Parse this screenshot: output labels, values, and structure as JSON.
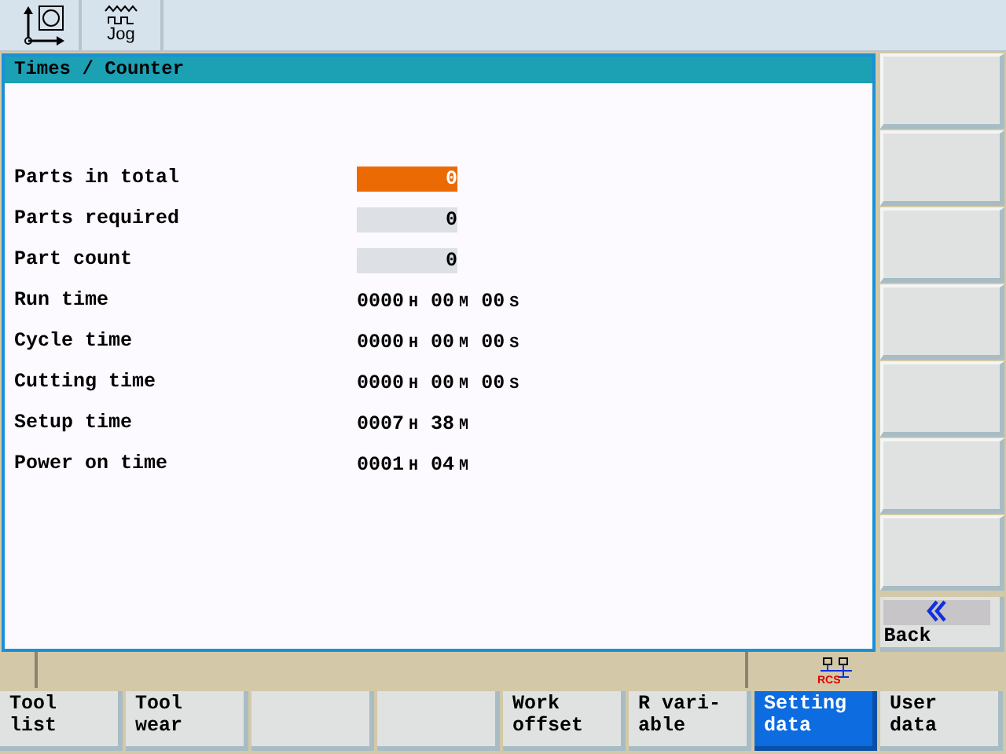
{
  "top_bar": {
    "tabs": [
      {
        "kind": "axes",
        "selected": false
      },
      {
        "kind": "jog",
        "label": "Jog",
        "selected": false
      }
    ]
  },
  "window": {
    "title": "Times / Counter"
  },
  "rows": [
    {
      "kind": "counter",
      "label": "Parts in total",
      "value": "0",
      "focused": true
    },
    {
      "kind": "counter",
      "label": "Parts required",
      "value": "0",
      "focused": false
    },
    {
      "kind": "counter",
      "label": "Part count",
      "value": "0",
      "focused": false
    },
    {
      "kind": "time",
      "label": "Run time",
      "parts": [
        {
          "value": "0000",
          "unit": "H"
        },
        {
          "value": "00",
          "unit": "M"
        },
        {
          "value": "00",
          "unit": "S"
        }
      ]
    },
    {
      "kind": "time",
      "label": "Cycle time",
      "parts": [
        {
          "value": "0000",
          "unit": "H"
        },
        {
          "value": "00",
          "unit": "M"
        },
        {
          "value": "00",
          "unit": "S"
        }
      ]
    },
    {
      "kind": "time",
      "label": "Cutting time",
      "parts": [
        {
          "value": "0000",
          "unit": "H"
        },
        {
          "value": "00",
          "unit": "M"
        },
        {
          "value": "00",
          "unit": "S"
        }
      ]
    },
    {
      "kind": "time",
      "label": "Setup time",
      "parts": [
        {
          "value": "0007",
          "unit": "H"
        },
        {
          "value": "38",
          "unit": "M"
        }
      ]
    },
    {
      "kind": "time",
      "label": "Power on time",
      "parts": [
        {
          "value": "0001",
          "unit": "H"
        },
        {
          "value": "04",
          "unit": "M"
        }
      ]
    }
  ],
  "vertical_softkeys": [
    {
      "kind": "blank"
    },
    {
      "kind": "blank"
    },
    {
      "kind": "blank"
    },
    {
      "kind": "blank"
    },
    {
      "kind": "blank"
    },
    {
      "kind": "blank"
    },
    {
      "kind": "blank"
    },
    {
      "kind": "back",
      "label": "Back"
    }
  ],
  "status_bar": {
    "rcs_label": "RCS"
  },
  "horizontal_softkeys": [
    {
      "kind": "text",
      "label": "Tool\nlist",
      "selected": false
    },
    {
      "kind": "text",
      "label": "Tool\nwear",
      "selected": false
    },
    {
      "kind": "blank",
      "selected": false
    },
    {
      "kind": "blank",
      "selected": false
    },
    {
      "kind": "text",
      "label": "Work\noffset",
      "selected": false
    },
    {
      "kind": "text",
      "label": "R vari-\nable",
      "selected": false
    },
    {
      "kind": "text",
      "label": "Setting\ndata",
      "selected": true
    },
    {
      "kind": "text",
      "label": "User\ndata",
      "selected": false
    }
  ]
}
